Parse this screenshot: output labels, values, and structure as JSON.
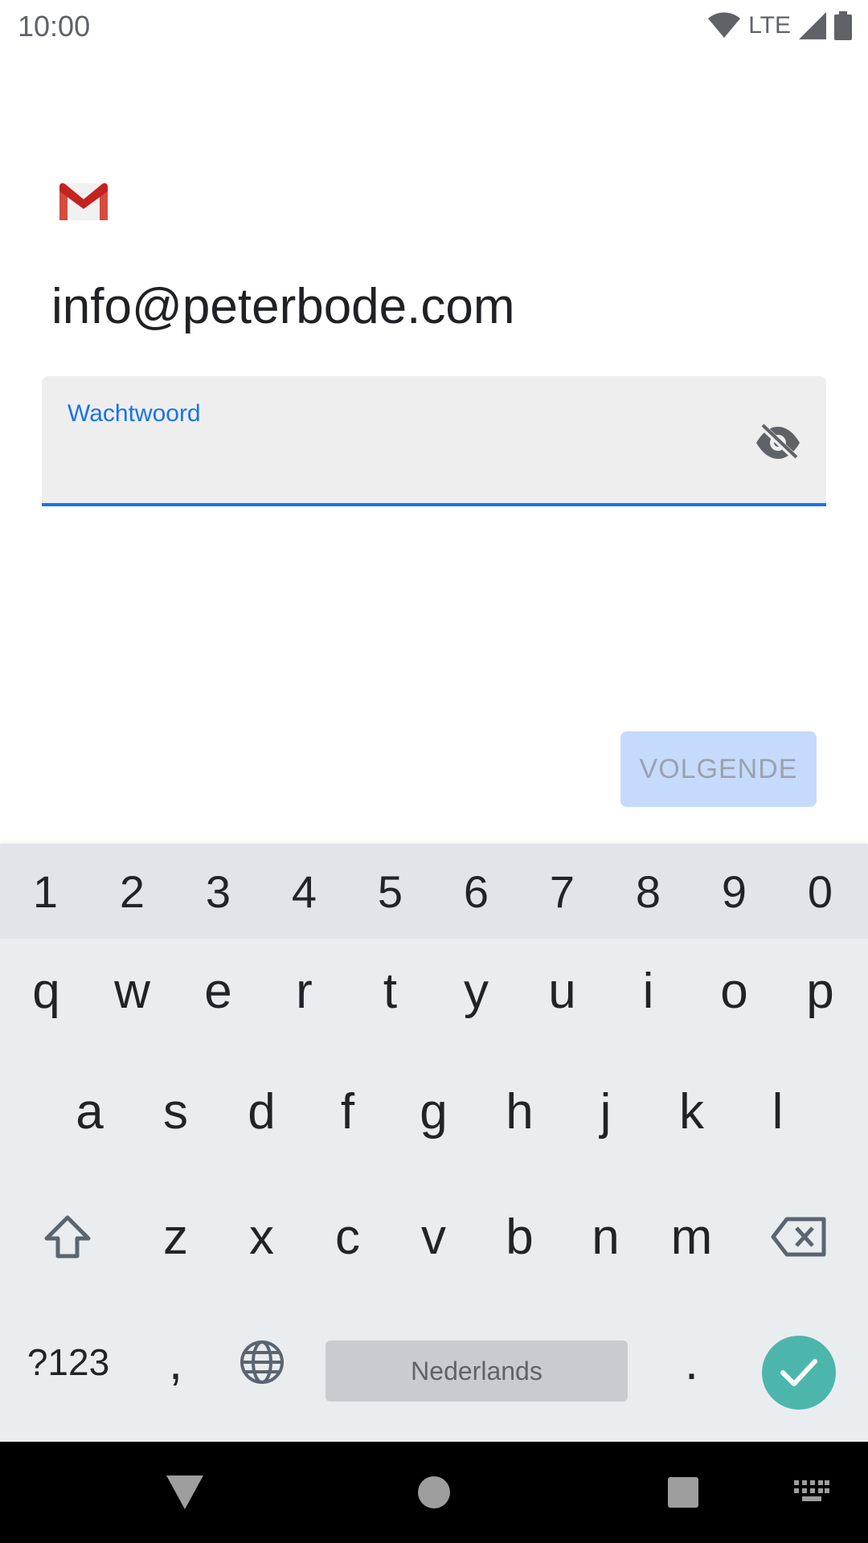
{
  "status_bar": {
    "time": "10:00",
    "network": "LTE"
  },
  "account": {
    "email": "info@peterbode.com"
  },
  "password_field": {
    "label": "Wachtwoord",
    "value": ""
  },
  "next_button": {
    "label": "VOLGENDE"
  },
  "keyboard": {
    "number_row": [
      "1",
      "2",
      "3",
      "4",
      "5",
      "6",
      "7",
      "8",
      "9",
      "0"
    ],
    "row_q": [
      "q",
      "w",
      "e",
      "r",
      "t",
      "y",
      "u",
      "i",
      "o",
      "p"
    ],
    "row_a": [
      "a",
      "s",
      "d",
      "f",
      "g",
      "h",
      "j",
      "k",
      "l"
    ],
    "row_z": [
      "z",
      "x",
      "c",
      "v",
      "b",
      "n",
      "m"
    ],
    "symbols_label": "?123",
    "comma": ",",
    "space_label": "Nederlands",
    "period": "."
  },
  "colors": {
    "accent": "#1a73e8",
    "button_disabled_bg": "#c6dafc",
    "enter_key": "#4db6ac"
  },
  "icons": [
    "wifi-icon",
    "signal-icon",
    "battery-icon",
    "gmail-logo",
    "visibility-off-icon",
    "shift-icon",
    "backspace-icon",
    "globe-icon",
    "check-icon",
    "back-icon",
    "home-icon",
    "recents-icon",
    "keyboard-icon"
  ]
}
